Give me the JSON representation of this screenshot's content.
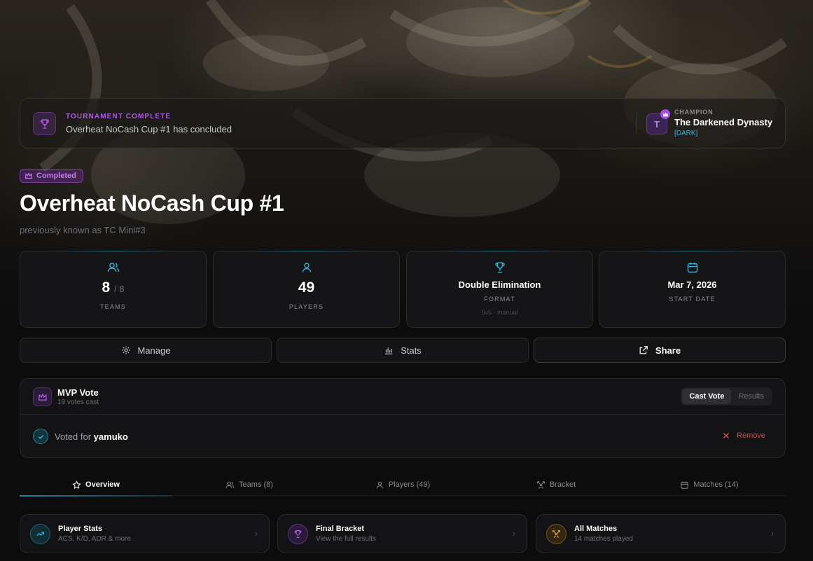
{
  "banner": {
    "kicker": "TOURNAMENT COMPLETE",
    "text": "Overheat NoCash Cup #1 has concluded",
    "champion_kicker": "CHAMPION",
    "champion_name": "The Darkened Dynasty",
    "champion_tag": "[DARK]",
    "champion_initial": "T"
  },
  "status_badge": "Completed",
  "title": "Overheat NoCash Cup #1",
  "subtitle": "previously known as TC Mini#3",
  "stats": {
    "teams_value": "8",
    "teams_max": "/ 8",
    "teams_label": "TEAMS",
    "players_value": "49",
    "players_label": "PLAYERS",
    "format_value": "Double Elimination",
    "format_label": "FORMAT",
    "format_sub": "5v5 · manual",
    "date_value": "Mar 7, 2026",
    "date_label": "START DATE"
  },
  "actions": {
    "manage": "Manage",
    "stats": "Stats",
    "share": "Share"
  },
  "mvp": {
    "title": "MVP Vote",
    "count": "19 votes cast",
    "seg_cast": "Cast Vote",
    "seg_results": "Results",
    "voted_prefix": "Voted for",
    "voted_name": "yamuko",
    "remove": "Remove"
  },
  "tabs": [
    {
      "label": "Overview"
    },
    {
      "label": "Teams (8)"
    },
    {
      "label": "Players (49)"
    },
    {
      "label": "Bracket"
    },
    {
      "label": "Matches (14)"
    }
  ],
  "quicklinks": [
    {
      "title": "Player Stats",
      "sub": "ACS, K/D, ADR & more"
    },
    {
      "title": "Final Bracket",
      "sub": "View the full results"
    },
    {
      "title": "All Matches",
      "sub": "14 matches played"
    }
  ],
  "colors": {
    "accent_purple": "#b15ae8",
    "accent_cyan": "#3ab0d4",
    "danger": "#d35050",
    "gold": "#d9a33a"
  }
}
